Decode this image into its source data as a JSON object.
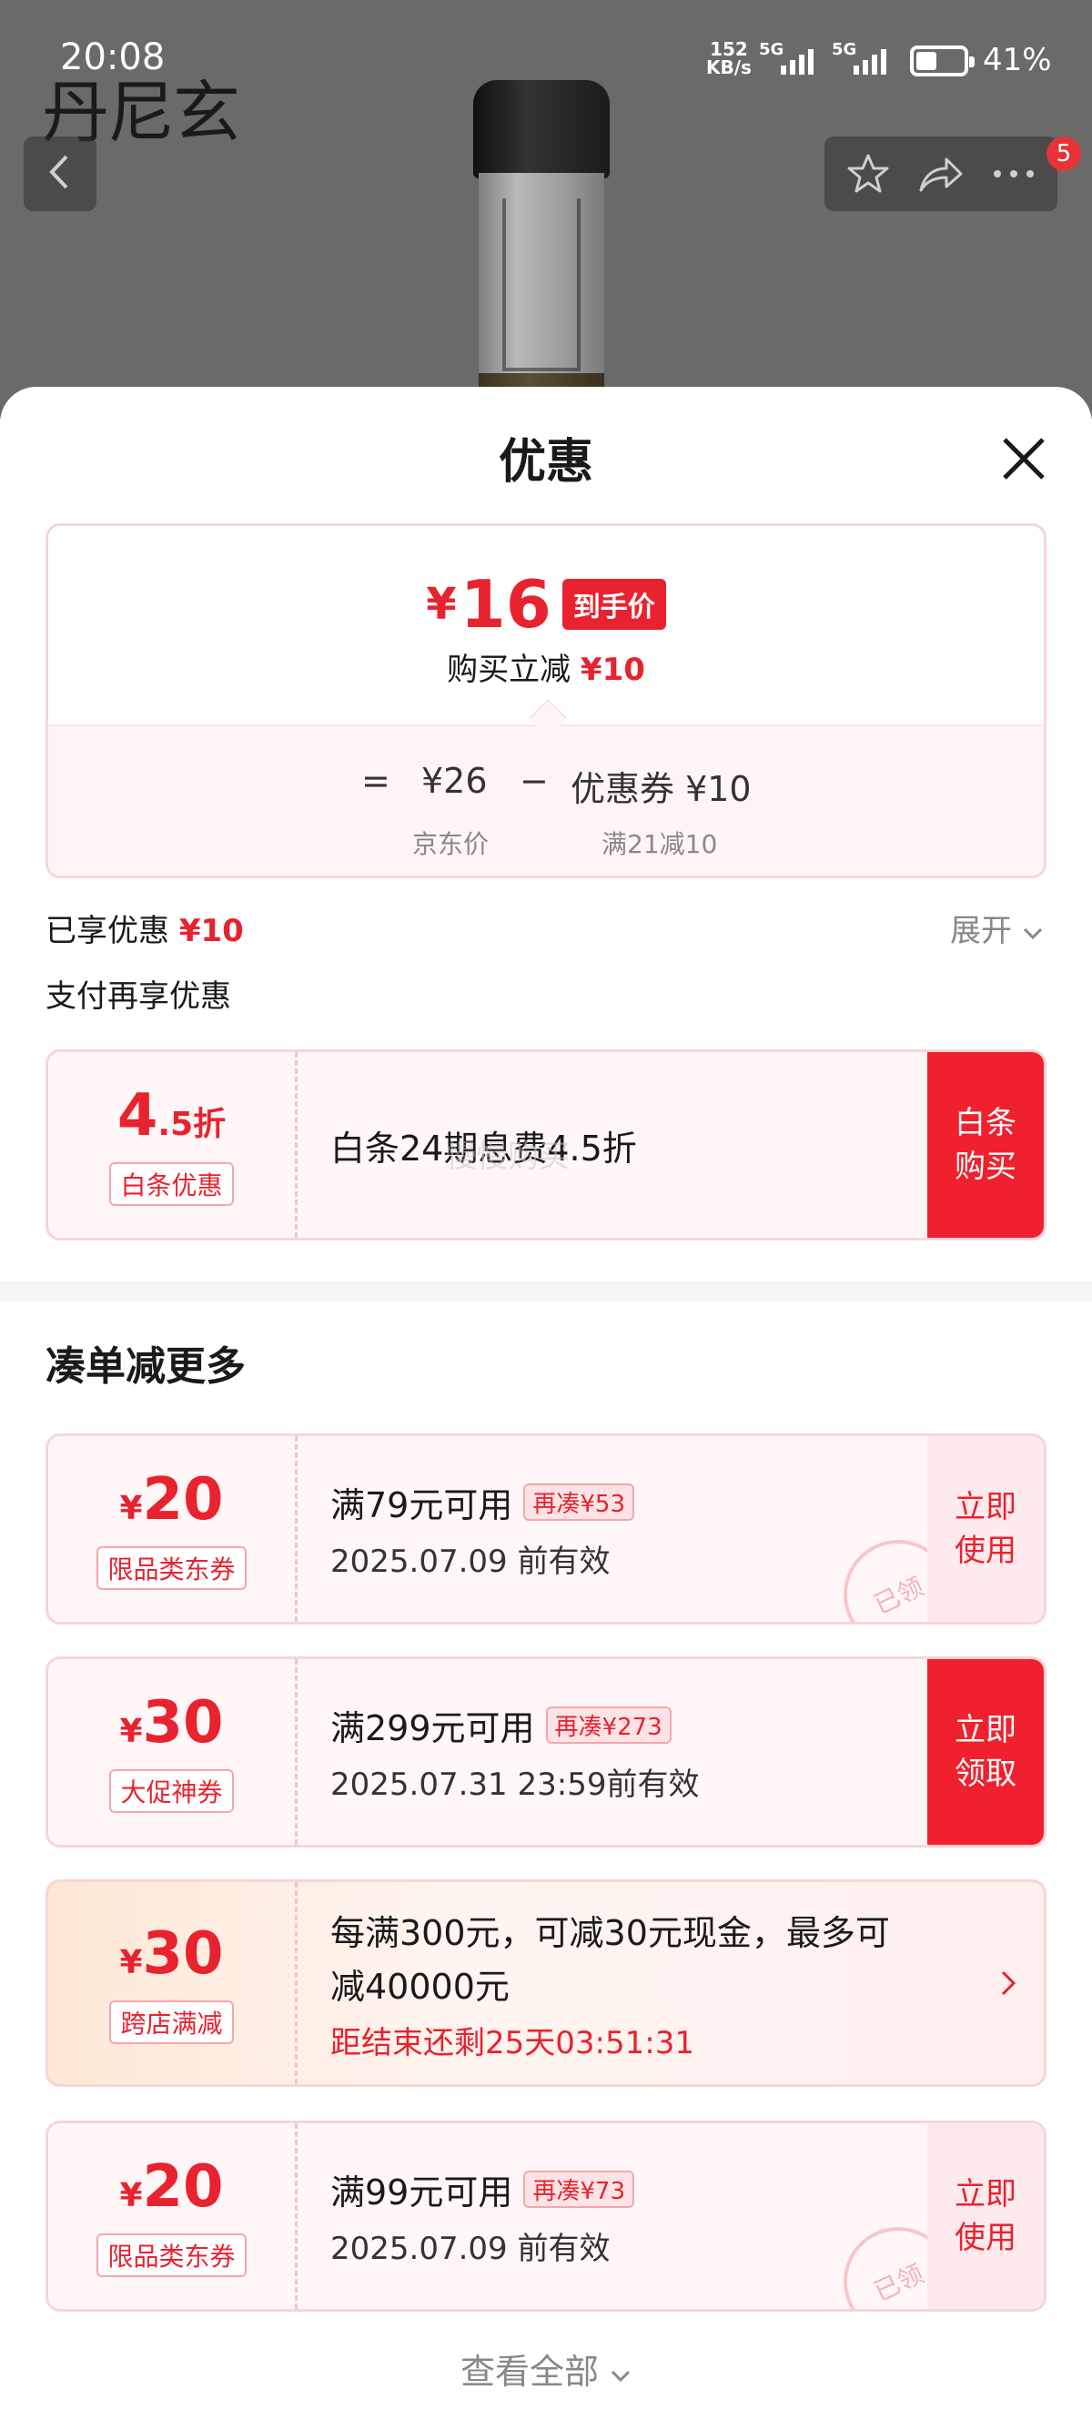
{
  "status": {
    "time": "20:08",
    "net_speed_value": "152",
    "net_speed_unit": "KB/s",
    "sim1": "5G",
    "sim2": "5G",
    "battery": "41%"
  },
  "background": {
    "logo_text": "丹尼玄"
  },
  "nav": {
    "badge_count": "5"
  },
  "sheet": {
    "title": "优惠",
    "price": {
      "yen": "¥",
      "amount": "16",
      "tag": "到手价",
      "sub_prefix": "购买立减",
      "sub_amount": "¥10",
      "eq": "=",
      "jd_price": "¥26",
      "minus": "−",
      "coupon_label": "优惠券 ¥10",
      "jd_price_label": "京东价",
      "coupon_rule": "满21减10"
    },
    "enjoyed_label": "已享优惠",
    "enjoyed_amount": "¥10",
    "expand_label": "展开",
    "pay_more_label": "支付再享优惠",
    "baitiao": {
      "value_big": "4",
      "value_small": ".5折",
      "tag": "白条优惠",
      "text": "白条24期息费4.5折",
      "action_line1": "白条",
      "action_line2": "购买"
    },
    "watermark": "慢慢购买",
    "section_title": "凑单减更多",
    "coupons": [
      {
        "yen": "¥",
        "value": "20",
        "tag": "限品类东券",
        "main": "满79元可用",
        "extra": "再凑¥53",
        "sub": "2025.07.09 前有效",
        "action1": "立即",
        "action2": "使用",
        "stamp": "已领"
      },
      {
        "yen": "¥",
        "value": "30",
        "tag": "大促神券",
        "main": "满299元可用",
        "extra": "再凑¥273",
        "sub": "2025.07.31 23:59前有效",
        "action1": "立即",
        "action2": "领取"
      },
      {
        "yen": "¥",
        "value": "30",
        "tag": "跨店满减",
        "main": "每满300元，可减30元现金，最多可",
        "main2": "减40000元",
        "sub": "距结束还剩25天03:51:31"
      },
      {
        "yen": "¥",
        "value": "20",
        "tag": "限品类东券",
        "main": "满99元可用",
        "extra": "再凑¥73",
        "sub": "2025.07.09 前有效",
        "action1": "立即",
        "action2": "使用",
        "stamp": "已领"
      }
    ],
    "view_all": "查看全部"
  },
  "colors": {
    "accent_red": "#e8222e",
    "card_pink": "#fff6f7"
  },
  "icons": [
    "back-arrow-icon",
    "star-icon",
    "share-icon",
    "more-icon",
    "close-icon",
    "chevron-down-icon",
    "chevron-right-icon"
  ]
}
